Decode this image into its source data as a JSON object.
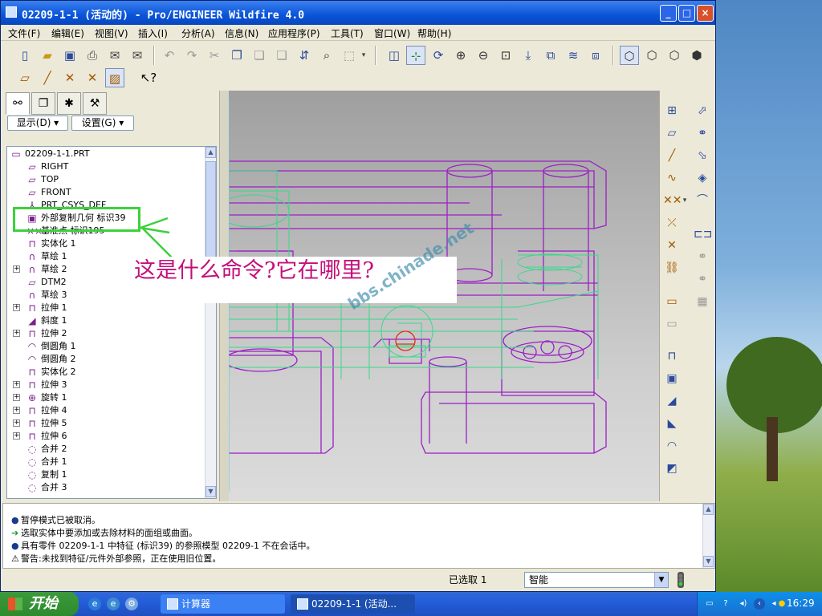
{
  "window": {
    "title": "02209-1-1 (活动的) - Pro/ENGINEER Wildfire 4.0",
    "min_glyph": "_",
    "max_glyph": "□",
    "close_glyph": "×"
  },
  "menu": [
    "文件(F)",
    "编辑(E)",
    "视图(V)",
    "插入(I)",
    "分析(A)",
    "信息(N)",
    "应用程序(P)",
    "工具(T)",
    "窗口(W)",
    "帮助(H)"
  ],
  "panel": {
    "show_button": "显示(D) ▾",
    "settings_button": "设置(G) ▾"
  },
  "tree": [
    {
      "label": "02209-1-1.PRT",
      "icon": "part-icon",
      "glyph": "▭",
      "exp": ""
    },
    {
      "label": "RIGHT",
      "icon": "datum-plane-icon",
      "glyph": "▱",
      "exp": ""
    },
    {
      "label": "TOP",
      "icon": "datum-plane-icon",
      "glyph": "▱",
      "exp": ""
    },
    {
      "label": "FRONT",
      "icon": "datum-plane-icon",
      "glyph": "▱",
      "exp": ""
    },
    {
      "label": "PRT_CSYS_DEF",
      "icon": "csys-icon",
      "glyph": "⅄",
      "exp": ""
    },
    {
      "label": "外部复制几何 标识39",
      "icon": "external-copy-geom-icon",
      "glyph": "▣",
      "exp": ""
    },
    {
      "label": "基准点 标识195",
      "icon": "datum-point-icon",
      "glyph": "××",
      "exp": ""
    },
    {
      "label": "实体化 1",
      "icon": "solidify-icon",
      "glyph": "⊓",
      "exp": ""
    },
    {
      "label": "草绘 1",
      "icon": "sketch-icon",
      "glyph": "∩",
      "exp": ""
    },
    {
      "label": "草绘 2",
      "icon": "sketch-icon",
      "glyph": "∩",
      "exp": "+"
    },
    {
      "label": "DTM2",
      "icon": "datum-plane-icon",
      "glyph": "▱",
      "exp": ""
    },
    {
      "label": "草绘 3",
      "icon": "sketch-icon",
      "glyph": "∩",
      "exp": ""
    },
    {
      "label": "拉伸 1",
      "icon": "extrude-icon",
      "glyph": "⊓",
      "exp": "+"
    },
    {
      "label": "斜度 1",
      "icon": "draft-icon",
      "glyph": "◢",
      "exp": ""
    },
    {
      "label": "拉伸 2",
      "icon": "extrude-icon",
      "glyph": "⊓",
      "exp": "+"
    },
    {
      "label": "倒圆角 1",
      "icon": "round-icon",
      "glyph": "◠",
      "exp": ""
    },
    {
      "label": "倒圆角 2",
      "icon": "round-icon",
      "glyph": "◠",
      "exp": ""
    },
    {
      "label": "实体化 2",
      "icon": "solidify-icon",
      "glyph": "⊓",
      "exp": ""
    },
    {
      "label": "拉伸 3",
      "icon": "extrude-icon",
      "glyph": "⊓",
      "exp": "+"
    },
    {
      "label": "旋转 1",
      "icon": "revolve-icon",
      "glyph": "⊕",
      "exp": "+"
    },
    {
      "label": "拉伸 4",
      "icon": "extrude-icon",
      "glyph": "⊓",
      "exp": "+"
    },
    {
      "label": "拉伸 5",
      "icon": "extrude-icon",
      "glyph": "⊓",
      "exp": "+"
    },
    {
      "label": "拉伸 6",
      "icon": "extrude-icon",
      "glyph": "⊓",
      "exp": "+"
    },
    {
      "label": "合并 2",
      "icon": "merge-icon",
      "glyph": "◌",
      "exp": ""
    },
    {
      "label": "合并 1",
      "icon": "merge-icon",
      "glyph": "◌",
      "exp": ""
    },
    {
      "label": "复制 1",
      "icon": "copy-icon",
      "glyph": "◌",
      "exp": ""
    },
    {
      "label": "合并 3",
      "icon": "merge-icon",
      "glyph": "◌",
      "exp": ""
    }
  ],
  "annotation": {
    "question": "这是什么命令?它在哪里?",
    "watermark": "bbs.chinade.net"
  },
  "messages": [
    {
      "text": "暂停模式已被取消。",
      "icon": "bullet-icon",
      "glyph": "●"
    },
    {
      "text": "选取实体中要添加或去除材料的面组或曲面。",
      "icon": "arrow-right-icon",
      "glyph": "➔"
    },
    {
      "text": "具有零件 02209-1-1 中特征 (标识39) 的参照模型 02209-1 不在会话中。",
      "icon": "bullet-icon",
      "glyph": "●"
    },
    {
      "text": "警告:未找到特征/元件外部参照，正在使用旧位置。",
      "icon": "warning-icon",
      "glyph": "⚠"
    }
  ],
  "status": {
    "selected": "已选取 1",
    "filter": "智能"
  },
  "taskbar": {
    "start": "开始",
    "tasks": [
      "计算器",
      "02209-1-1 (活动..."
    ],
    "clock": "16:29"
  },
  "colors": {
    "highlight": "#3cd13c",
    "annotation_text": "#c4107a",
    "model_edges": "#9b1fc4",
    "reference_edges": "#39d88a"
  }
}
